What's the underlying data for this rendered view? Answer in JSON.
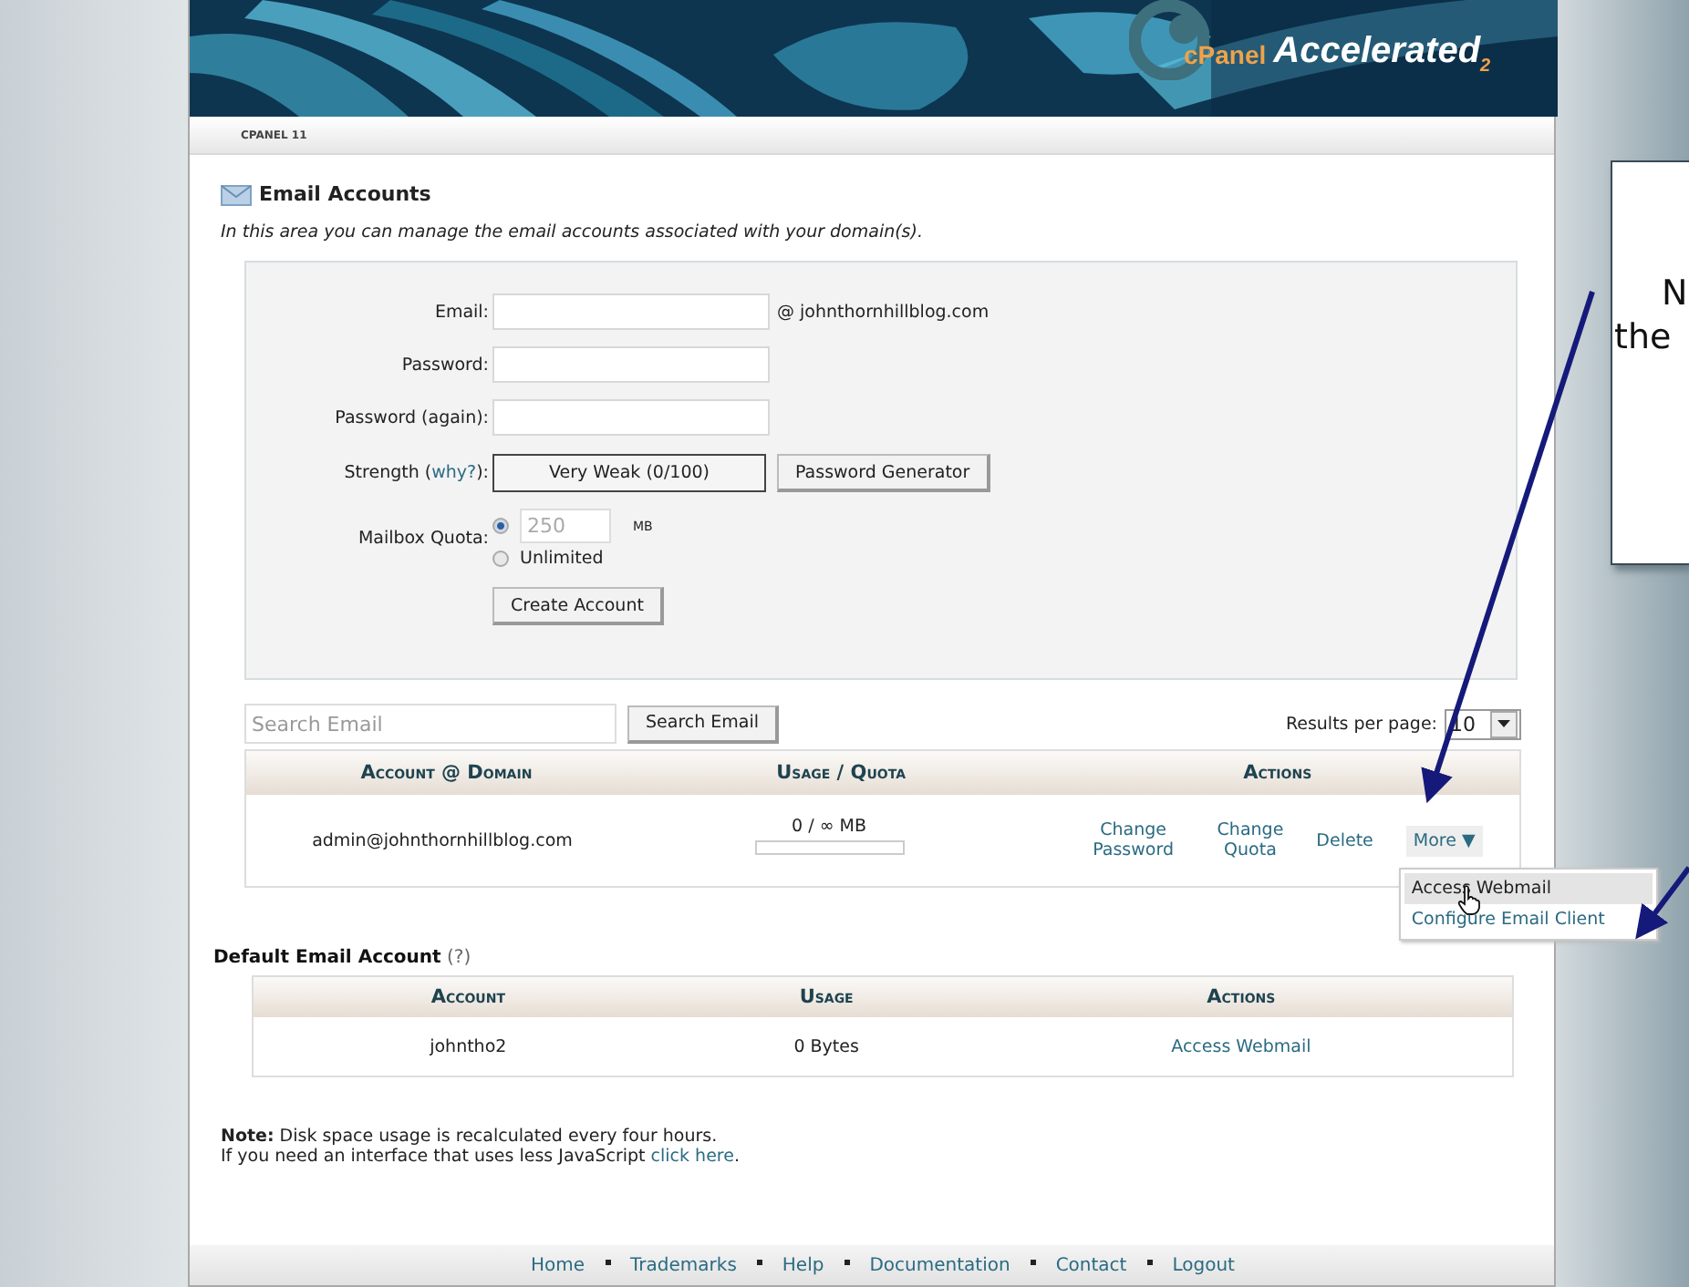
{
  "header": {
    "logo": "cPanel",
    "logo_subtitle": "Accelerated$_{2}$",
    "breadcrumb": "CPANEL 11"
  },
  "page": {
    "title": "Email Accounts",
    "intro": "In this area you can manage the email accounts associated with your domain(s)."
  },
  "form": {
    "email_label": "Email:",
    "domain": "@ johnthornhillblog.com",
    "password_label": "Password:",
    "password_again_label": "Password (again):",
    "strength_label": {
      "before": "Strength (",
      "link": "why?",
      "after": "):"
    },
    "strength_value": "Very Weak (0/100)",
    "generator_button": "Password Generator",
    "quota_label": "Mailbox Quota:",
    "quota_options": [
      {
        "kind": "amount",
        "selected": true,
        "value": "250",
        "unit": "MB"
      },
      {
        "kind": "label",
        "selected": false,
        "label": "Unlimited"
      }
    ],
    "create_button": "Create Account"
  },
  "search": {
    "placeholder": "Search Email",
    "button": "Search Email",
    "results_label": "Results per page:",
    "results_value": "10"
  },
  "accounts_table": {
    "columns": [
      "Account @ Domain",
      "Usage / Quota",
      "Actions"
    ],
    "rows": [
      {
        "account": "admin@johnthornhillblog.com",
        "usage": "0 / ∞ MB",
        "level": 0,
        "actions": [
          "Change Password",
          "Change Quota",
          "Delete"
        ],
        "more": {
          "label": "More ▼",
          "expanded": true,
          "menu": [
            {
              "label": "Access Webmail",
              "selected": true
            },
            {
              "label": "Configure Email Client",
              "selected": false
            }
          ]
        }
      }
    ]
  },
  "default_account": {
    "title": "**Default Email Account** (?)",
    "columns": [
      "Account",
      "Usage",
      "Actions"
    ],
    "rows": [
      {
        "account": "johntho2",
        "usage": "0 Bytes",
        "action": "Access Webmail"
      }
    ]
  },
  "note": {
    "line1": "**Note:** Disk space usage is recalculated every four hours.",
    "line2": {
      "text": "If you need an interface that uses less JavaScript ",
      "link": "click here",
      "after": "."
    }
  },
  "footer": {
    "links": [
      "Home",
      "Trademarks",
      "Help",
      "Documentation",
      "Contact",
      "Logout"
    ]
  },
  "callout": {
    "lines": [
      "N",
      "the"
    ]
  }
}
